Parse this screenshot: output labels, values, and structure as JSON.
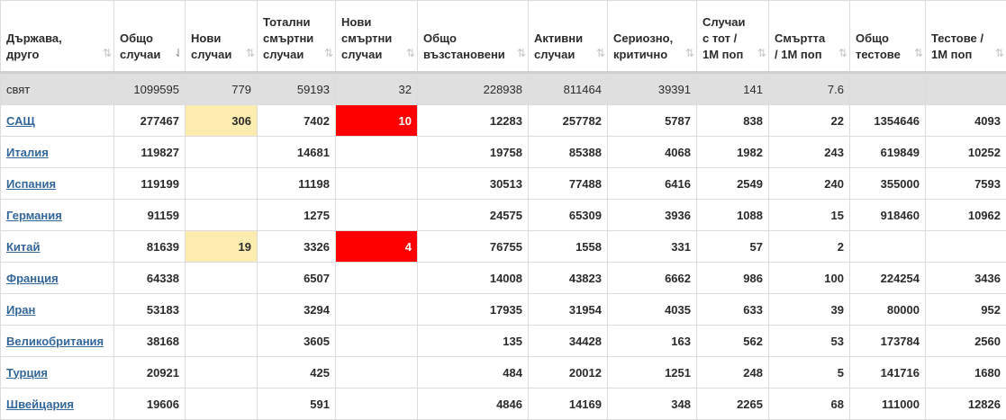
{
  "headers": [
    {
      "label": "Държава, друго",
      "sort_active": false
    },
    {
      "label": "Общо случаи",
      "sort_active": true
    },
    {
      "label": "Нови случаи",
      "sort_active": false
    },
    {
      "label": "Тотални смъртни случаи",
      "sort_active": false
    },
    {
      "label": "Нови смъртни случаи",
      "sort_active": false
    },
    {
      "label": "Общо възстановени",
      "sort_active": false
    },
    {
      "label": "Активни случаи",
      "sort_active": false
    },
    {
      "label": "Сериозно, критично",
      "sort_active": false
    },
    {
      "label": "Случаи с тот / 1M поп",
      "sort_active": false
    },
    {
      "label": "Смъртта / 1M поп",
      "sort_active": false
    },
    {
      "label": "Общо тестове",
      "sort_active": false
    },
    {
      "label": "Тестове / 1M поп",
      "sort_active": false
    }
  ],
  "sort_icon": "⇅",
  "sort_icon_active": "⇃",
  "world": {
    "name": "свят",
    "total_cases": "1099595",
    "new_cases": "779",
    "total_deaths": "59193",
    "new_deaths": "32",
    "total_recovered": "228938",
    "active_cases": "811464",
    "serious_critical": "39391",
    "cases_per_1m": "141",
    "deaths_per_1m": "7.6",
    "total_tests": "",
    "tests_per_1m": ""
  },
  "rows": [
    {
      "name": "САЩ",
      "total_cases": "277467",
      "new_cases": "306",
      "total_deaths": "7402",
      "new_deaths": "10",
      "total_recovered": "12283",
      "active_cases": "257782",
      "serious_critical": "5787",
      "cases_per_1m": "838",
      "deaths_per_1m": "22",
      "total_tests": "1354646",
      "tests_per_1m": "4093"
    },
    {
      "name": "Италия",
      "total_cases": "119827",
      "new_cases": "",
      "total_deaths": "14681",
      "new_deaths": "",
      "total_recovered": "19758",
      "active_cases": "85388",
      "serious_critical": "4068",
      "cases_per_1m": "1982",
      "deaths_per_1m": "243",
      "total_tests": "619849",
      "tests_per_1m": "10252"
    },
    {
      "name": "Испания",
      "total_cases": "119199",
      "new_cases": "",
      "total_deaths": "11198",
      "new_deaths": "",
      "total_recovered": "30513",
      "active_cases": "77488",
      "serious_critical": "6416",
      "cases_per_1m": "2549",
      "deaths_per_1m": "240",
      "total_tests": "355000",
      "tests_per_1m": "7593"
    },
    {
      "name": "Германия",
      "total_cases": "91159",
      "new_cases": "",
      "total_deaths": "1275",
      "new_deaths": "",
      "total_recovered": "24575",
      "active_cases": "65309",
      "serious_critical": "3936",
      "cases_per_1m": "1088",
      "deaths_per_1m": "15",
      "total_tests": "918460",
      "tests_per_1m": "10962"
    },
    {
      "name": "Китай",
      "total_cases": "81639",
      "new_cases": "19",
      "total_deaths": "3326",
      "new_deaths": "4",
      "total_recovered": "76755",
      "active_cases": "1558",
      "serious_critical": "331",
      "cases_per_1m": "57",
      "deaths_per_1m": "2",
      "total_tests": "",
      "tests_per_1m": ""
    },
    {
      "name": "Франция",
      "total_cases": "64338",
      "new_cases": "",
      "total_deaths": "6507",
      "new_deaths": "",
      "total_recovered": "14008",
      "active_cases": "43823",
      "serious_critical": "6662",
      "cases_per_1m": "986",
      "deaths_per_1m": "100",
      "total_tests": "224254",
      "tests_per_1m": "3436"
    },
    {
      "name": "Иран",
      "total_cases": "53183",
      "new_cases": "",
      "total_deaths": "3294",
      "new_deaths": "",
      "total_recovered": "17935",
      "active_cases": "31954",
      "serious_critical": "4035",
      "cases_per_1m": "633",
      "deaths_per_1m": "39",
      "total_tests": "80000",
      "tests_per_1m": "952"
    },
    {
      "name": "Великобритания",
      "total_cases": "38168",
      "new_cases": "",
      "total_deaths": "3605",
      "new_deaths": "",
      "total_recovered": "135",
      "active_cases": "34428",
      "serious_critical": "163",
      "cases_per_1m": "562",
      "deaths_per_1m": "53",
      "total_tests": "173784",
      "tests_per_1m": "2560"
    },
    {
      "name": "Турция",
      "total_cases": "20921",
      "new_cases": "",
      "total_deaths": "425",
      "new_deaths": "",
      "total_recovered": "484",
      "active_cases": "20012",
      "serious_critical": "1251",
      "cases_per_1m": "248",
      "deaths_per_1m": "5",
      "total_tests": "141716",
      "tests_per_1m": "1680"
    },
    {
      "name": "Швейцария",
      "total_cases": "19606",
      "new_cases": "",
      "total_deaths": "591",
      "new_deaths": "",
      "total_recovered": "4846",
      "active_cases": "14169",
      "serious_critical": "348",
      "cases_per_1m": "2265",
      "deaths_per_1m": "68",
      "total_tests": "111000",
      "tests_per_1m": "12826"
    }
  ],
  "colors": {
    "new_cases_highlight": "#fcecb0",
    "new_deaths_highlight": "#ff0000",
    "link": "#336699",
    "world_row_bg": "#dfdfdf"
  }
}
